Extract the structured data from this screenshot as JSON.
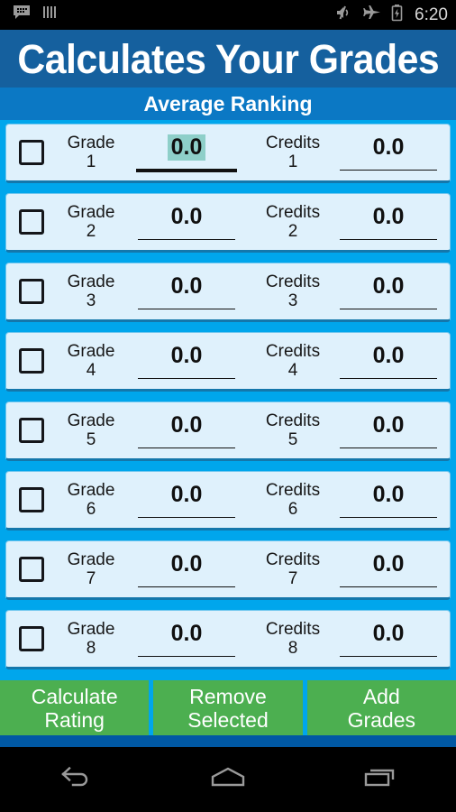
{
  "statusbar": {
    "icons_left": [
      "bbm-chat-icon",
      "bars-icon"
    ],
    "icons_right": [
      "mute-icon",
      "airplane-mode-icon",
      "battery-charging-icon"
    ],
    "time": "6:20"
  },
  "header": {
    "title": "Calculates Your Grades",
    "subtitle": "Average Ranking"
  },
  "rows": [
    {
      "checked": false,
      "grade_label": "Grade",
      "grade_index": "1",
      "grade_value": "0.0",
      "credits_label": "Credits",
      "credits_index": "1",
      "credits_value": "0.0",
      "grade_focused": true
    },
    {
      "checked": false,
      "grade_label": "Grade",
      "grade_index": "2",
      "grade_value": "0.0",
      "credits_label": "Credits",
      "credits_index": "2",
      "credits_value": "0.0",
      "grade_focused": false
    },
    {
      "checked": false,
      "grade_label": "Grade",
      "grade_index": "3",
      "grade_value": "0.0",
      "credits_label": "Credits",
      "credits_index": "3",
      "credits_value": "0.0",
      "grade_focused": false
    },
    {
      "checked": false,
      "grade_label": "Grade",
      "grade_index": "4",
      "grade_value": "0.0",
      "credits_label": "Credits",
      "credits_index": "4",
      "credits_value": "0.0",
      "grade_focused": false
    },
    {
      "checked": false,
      "grade_label": "Grade",
      "grade_index": "5",
      "grade_value": "0.0",
      "credits_label": "Credits",
      "credits_index": "5",
      "credits_value": "0.0",
      "grade_focused": false
    },
    {
      "checked": false,
      "grade_label": "Grade",
      "grade_index": "6",
      "grade_value": "0.0",
      "credits_label": "Credits",
      "credits_index": "6",
      "credits_value": "0.0",
      "grade_focused": false
    },
    {
      "checked": false,
      "grade_label": "Grade",
      "grade_index": "7",
      "grade_value": "0.0",
      "credits_label": "Credits",
      "credits_index": "7",
      "credits_value": "0.0",
      "grade_focused": false
    },
    {
      "checked": false,
      "grade_label": "Grade",
      "grade_index": "8",
      "grade_value": "0.0",
      "credits_label": "Credits",
      "credits_index": "8",
      "credits_value": "0.0",
      "grade_focused": false
    }
  ],
  "buttons": [
    {
      "line1": "Calculate",
      "line2": "Rating"
    },
    {
      "line1": "Remove",
      "line2": "Selected"
    },
    {
      "line1": "Add",
      "line2": "Grades"
    }
  ],
  "navbar": {
    "back": "back-icon",
    "home": "home-icon",
    "recents": "recents-icon"
  },
  "colors": {
    "page_background": "#00a6ec",
    "title_bar": "#15609e",
    "subtitle_bar": "#0b78c4",
    "row_background": "#dff1fc",
    "row_shadow": "#1477ab",
    "button_green": "#4caf50",
    "selection_teal": "#8ecfc9",
    "bottom_strip": "#0058a3"
  }
}
